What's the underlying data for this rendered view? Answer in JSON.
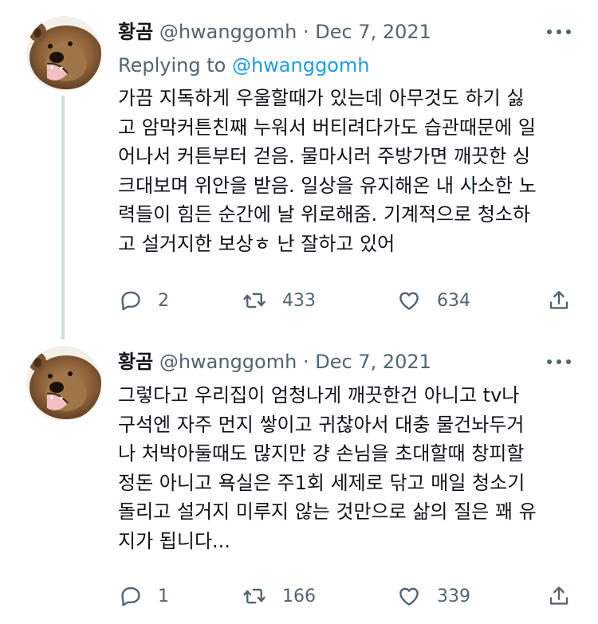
{
  "tweets": [
    {
      "name": "황곰",
      "handle": "@hwanggomh",
      "sep": "·",
      "date": "Dec 7, 2021",
      "replying_prefix": "Replying to",
      "replying_handle": "@hwanggomh",
      "lines": [
        "가끔 지독하게 우울할때가 있는데 아무것도 하기 싫",
        "고 암막커튼친째 누워서 버티려다가도 습관때문에 일",
        "어나서 커튼부터 걷음. 물마시러 주방가면  깨끗한 싱",
        "크대보며 위안을 받음. 일상을 유지해온 내 사소한 노",
        "력들이 힘든 순간에 날 위로해줌. 기계적으로 청소하",
        "고 설거지한 보상ㅎ 난 잘하고 있어"
      ],
      "replies": "2",
      "retweets": "433",
      "likes": "634"
    },
    {
      "name": "황곰",
      "handle": "@hwanggomh",
      "sep": "·",
      "date": "Dec 7, 2021",
      "lines": [
        "그렇다고 우리집이 엄청나게 깨끗한건 아니고 tv나",
        "구석엔 자주 먼지 쌓이고 귀찮아서 대충 물건놔두거",
        "나 처박아둘때도 많지만 걍 손님을 초대할때 창피할",
        "정돈 아니고 욕실은 주1회 세제로 닦고 매일 청소기",
        "돌리고 설거지 미루지 않는 것만으로 삶의 질은 꽤 유",
        "지가 됩니다..."
      ],
      "replies": "1",
      "retweets": "166",
      "likes": "339"
    }
  ],
  "icons": {
    "reply": "reply-icon",
    "retweet": "retweet-icon",
    "like": "heart-icon",
    "share": "share-icon",
    "more": "more-icon"
  },
  "colors": {
    "text": "#0f1419",
    "secondary": "#536471",
    "link": "#1d9bf0",
    "thread_line": "#cfd9de"
  }
}
